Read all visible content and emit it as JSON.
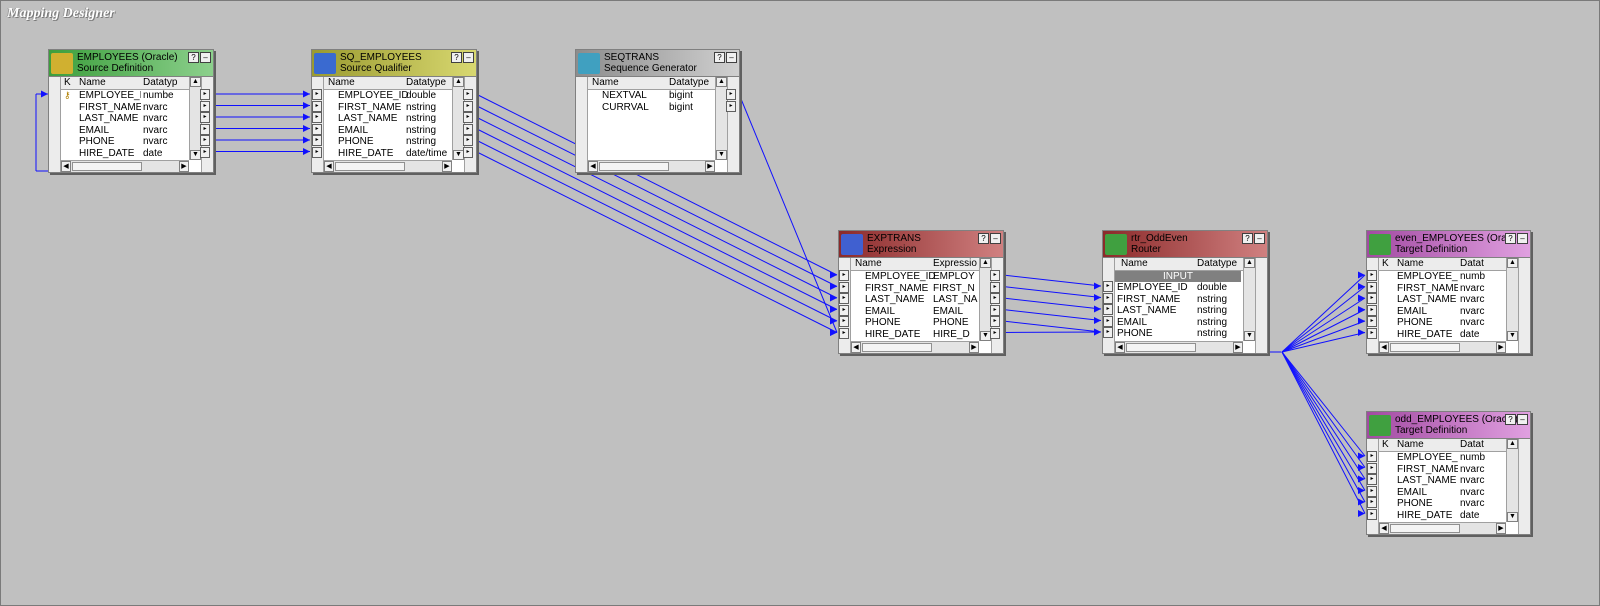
{
  "designer_title": "Mapping Designer",
  "col_k": "K",
  "col_name": "Name",
  "input_group": "INPUT",
  "colors": {
    "canvas": "#c0c0c0",
    "link": "#1010ff",
    "source": "#3c9e3c",
    "qualifier": "#9a9a30",
    "sequence": "#8c8c8c",
    "expression": "#8b2a2a",
    "router": "#8b2a2a",
    "target": "#a24aa2"
  },
  "employees": {
    "name": "EMPLOYEES (Oracle)",
    "type": "Source Definition",
    "datatype_header": "Datatyp",
    "icon": "source-definition-icon",
    "rows": [
      {
        "name": "EMPLOYEE_ID",
        "type": "numbe",
        "key": true
      },
      {
        "name": "FIRST_NAME",
        "type": "nvarc"
      },
      {
        "name": "LAST_NAME",
        "type": "nvarc"
      },
      {
        "name": "EMAIL",
        "type": "nvarc"
      },
      {
        "name": "PHONE",
        "type": "nvarc"
      },
      {
        "name": "HIRE_DATE",
        "type": "date"
      }
    ]
  },
  "sq": {
    "name": "SQ_EMPLOYEES",
    "type": "Source Qualifier",
    "datatype_header": "Datatype",
    "icon": "source-qualifier-icon",
    "rows": [
      {
        "name": "EMPLOYEE_ID",
        "type": "double"
      },
      {
        "name": "FIRST_NAME",
        "type": "nstring"
      },
      {
        "name": "LAST_NAME",
        "type": "nstring"
      },
      {
        "name": "EMAIL",
        "type": "nstring"
      },
      {
        "name": "PHONE",
        "type": "nstring"
      },
      {
        "name": "HIRE_DATE",
        "type": "date/time"
      }
    ]
  },
  "seq": {
    "name": "SEQTRANS",
    "type": "Sequence Generator",
    "datatype_header": "Datatype",
    "icon": "sequence-generator-icon",
    "rows": [
      {
        "name": "NEXTVAL",
        "type": "bigint"
      },
      {
        "name": "CURRVAL",
        "type": "bigint"
      }
    ]
  },
  "exp": {
    "name": "EXPTRANS",
    "type": "Expression",
    "datatype_header": "Expressio",
    "icon": "expression-icon",
    "rows": [
      {
        "name": "EMPLOYEE_ID",
        "type": "EMPLOY"
      },
      {
        "name": "FIRST_NAME",
        "type": "FIRST_N"
      },
      {
        "name": "LAST_NAME",
        "type": "LAST_NA"
      },
      {
        "name": "EMAIL",
        "type": "EMAIL"
      },
      {
        "name": "PHONE",
        "type": "PHONE"
      },
      {
        "name": "HIRE_DATE",
        "type": "HIRE_D"
      }
    ]
  },
  "rtr": {
    "name": "rtr_OddEven",
    "type": "Router",
    "datatype_header": "Datatype",
    "icon": "router-icon",
    "rows": [
      {
        "name": "EMPLOYEE_ID",
        "type": "double"
      },
      {
        "name": "FIRST_NAME",
        "type": "nstring"
      },
      {
        "name": "LAST_NAME",
        "type": "nstring"
      },
      {
        "name": "EMAIL",
        "type": "nstring"
      },
      {
        "name": "PHONE",
        "type": "nstring"
      }
    ]
  },
  "even": {
    "name": "even_EMPLOYEES (Orac",
    "type": "Target Definition",
    "datatype_header": "Datat",
    "icon": "target-definition-icon",
    "rows": [
      {
        "name": "EMPLOYEE_ID",
        "type": "numb"
      },
      {
        "name": "FIRST_NAME",
        "type": "nvarc"
      },
      {
        "name": "LAST_NAME",
        "type": "nvarc"
      },
      {
        "name": "EMAIL",
        "type": "nvarc"
      },
      {
        "name": "PHONE",
        "type": "nvarc"
      },
      {
        "name": "HIRE_DATE",
        "type": "date"
      }
    ]
  },
  "odd": {
    "name": "odd_EMPLOYEES (Oracle)",
    "type": "Target Definition",
    "datatype_header": "Datat",
    "icon": "target-definition-icon",
    "rows": [
      {
        "name": "EMPLOYEE_ID",
        "type": "numb"
      },
      {
        "name": "FIRST_NAME",
        "type": "nvarc"
      },
      {
        "name": "LAST_NAME",
        "type": "nvarc"
      },
      {
        "name": "EMAIL",
        "type": "nvarc"
      },
      {
        "name": "PHONE",
        "type": "nvarc"
      },
      {
        "name": "HIRE_DATE",
        "type": "date"
      }
    ]
  }
}
